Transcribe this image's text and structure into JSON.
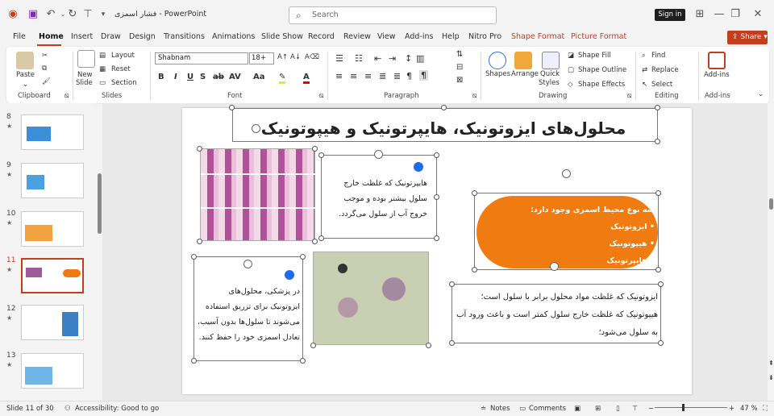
{
  "window": {
    "doc_name": "فشار اسمزی",
    "separator": "-",
    "app_name": "PowerPoint",
    "search_placeholder": "Search",
    "signin_label": "Sign in"
  },
  "menu": {
    "items": [
      "File",
      "Home",
      "Insert",
      "Draw",
      "Design",
      "Transitions",
      "Animations",
      "Slide Show",
      "Record",
      "Review",
      "View",
      "Add-ins",
      "Help",
      "Nitro Pro",
      "Shape Format",
      "Picture Format"
    ],
    "share_label": "Share"
  },
  "ribbon": {
    "clipboard": {
      "paste": "Paste",
      "label": "Clipboard"
    },
    "slides": {
      "new_slide": "New",
      "new_slide2": "Slide",
      "layout": "Layout",
      "reset": "Reset",
      "section": "Section",
      "label": "Slides"
    },
    "font": {
      "name": "Shabnam",
      "size": "18+",
      "label": "Font"
    },
    "paragraph": {
      "label": "Paragraph"
    },
    "drawing": {
      "shapes": "Shapes",
      "arrange": "Arrange",
      "quick": "Quick",
      "styles": "Styles",
      "shape_fill": "Shape Fill",
      "shape_outline": "Shape Outline",
      "shape_effects": "Shape Effects",
      "label": "Drawing"
    },
    "editing": {
      "find": "Find",
      "replace": "Replace",
      "select": "Select",
      "label": "Editing"
    },
    "addins": {
      "addins": "Add-ins",
      "label": "Add-ins"
    }
  },
  "thumbnails": [
    {
      "num": "8",
      "star": "★"
    },
    {
      "num": "9",
      "star": "★"
    },
    {
      "num": "10",
      "star": "★"
    },
    {
      "num": "11",
      "star": "★"
    },
    {
      "num": "12",
      "star": "★"
    },
    {
      "num": "13",
      "star": "★"
    }
  ],
  "slide": {
    "title": "محلول‌های ایزوتونیک، هایپرتونیک و هیپوتونیک",
    "hyper_text": "هایپرتونیک که غلظت خارج سلول بیشتر بوده و موجب خروج آب از سلول می‌گردد.",
    "iso_med_text": "در پزشکی، محلول‌های ایزوتونیک برای تزریق استفاده می‌شوند تا سلول‌ها بدون آسیب، تعادل اسمزی خود را حفظ کنند.",
    "pill_header": "سه نوع محیط اسمزی وجود دارد:",
    "pill_items": [
      "ایزوتونیک",
      "هیپوتونیک",
      "هایپرتونیک"
    ],
    "iso_hypo_text": "ایزوتونیک که غلظت مواد محلول برابر با سلول است؛ هیپوتونیک که غلظت خارج سلول کمتر است و باعث ورود آب به سلول می‌شود؛"
  },
  "status": {
    "slide_info": "Slide 11 of 30",
    "accessibility": "Accessibility: Good to go",
    "notes": "Notes",
    "comments": "Comments",
    "zoom": "47 %"
  },
  "colors": {
    "accent": "#c43e1c",
    "pill": "#f07b10",
    "handle_blue": "#1e6bf0"
  }
}
